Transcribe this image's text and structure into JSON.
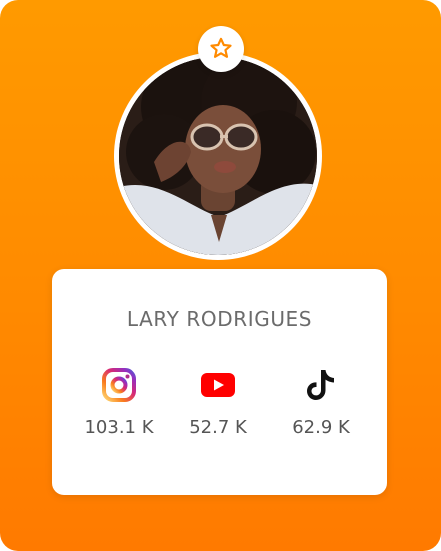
{
  "profile": {
    "name": "LARY RODRIGUES"
  },
  "badge": {
    "icon": "star-icon"
  },
  "stats": [
    {
      "platform": "instagram",
      "icon": "instagram-icon",
      "count": "103.1 K"
    },
    {
      "platform": "youtube",
      "icon": "youtube-icon",
      "count": "52.7 K"
    },
    {
      "platform": "tiktok",
      "icon": "tiktok-icon",
      "count": "62.9 K"
    }
  ],
  "colors": {
    "background_top": "#ff9a00",
    "background_bottom": "#ff7a00",
    "panel": "#ffffff",
    "text": "#6b6b6b",
    "youtube": "#ff0000",
    "badge_star": "#ff8a00"
  }
}
